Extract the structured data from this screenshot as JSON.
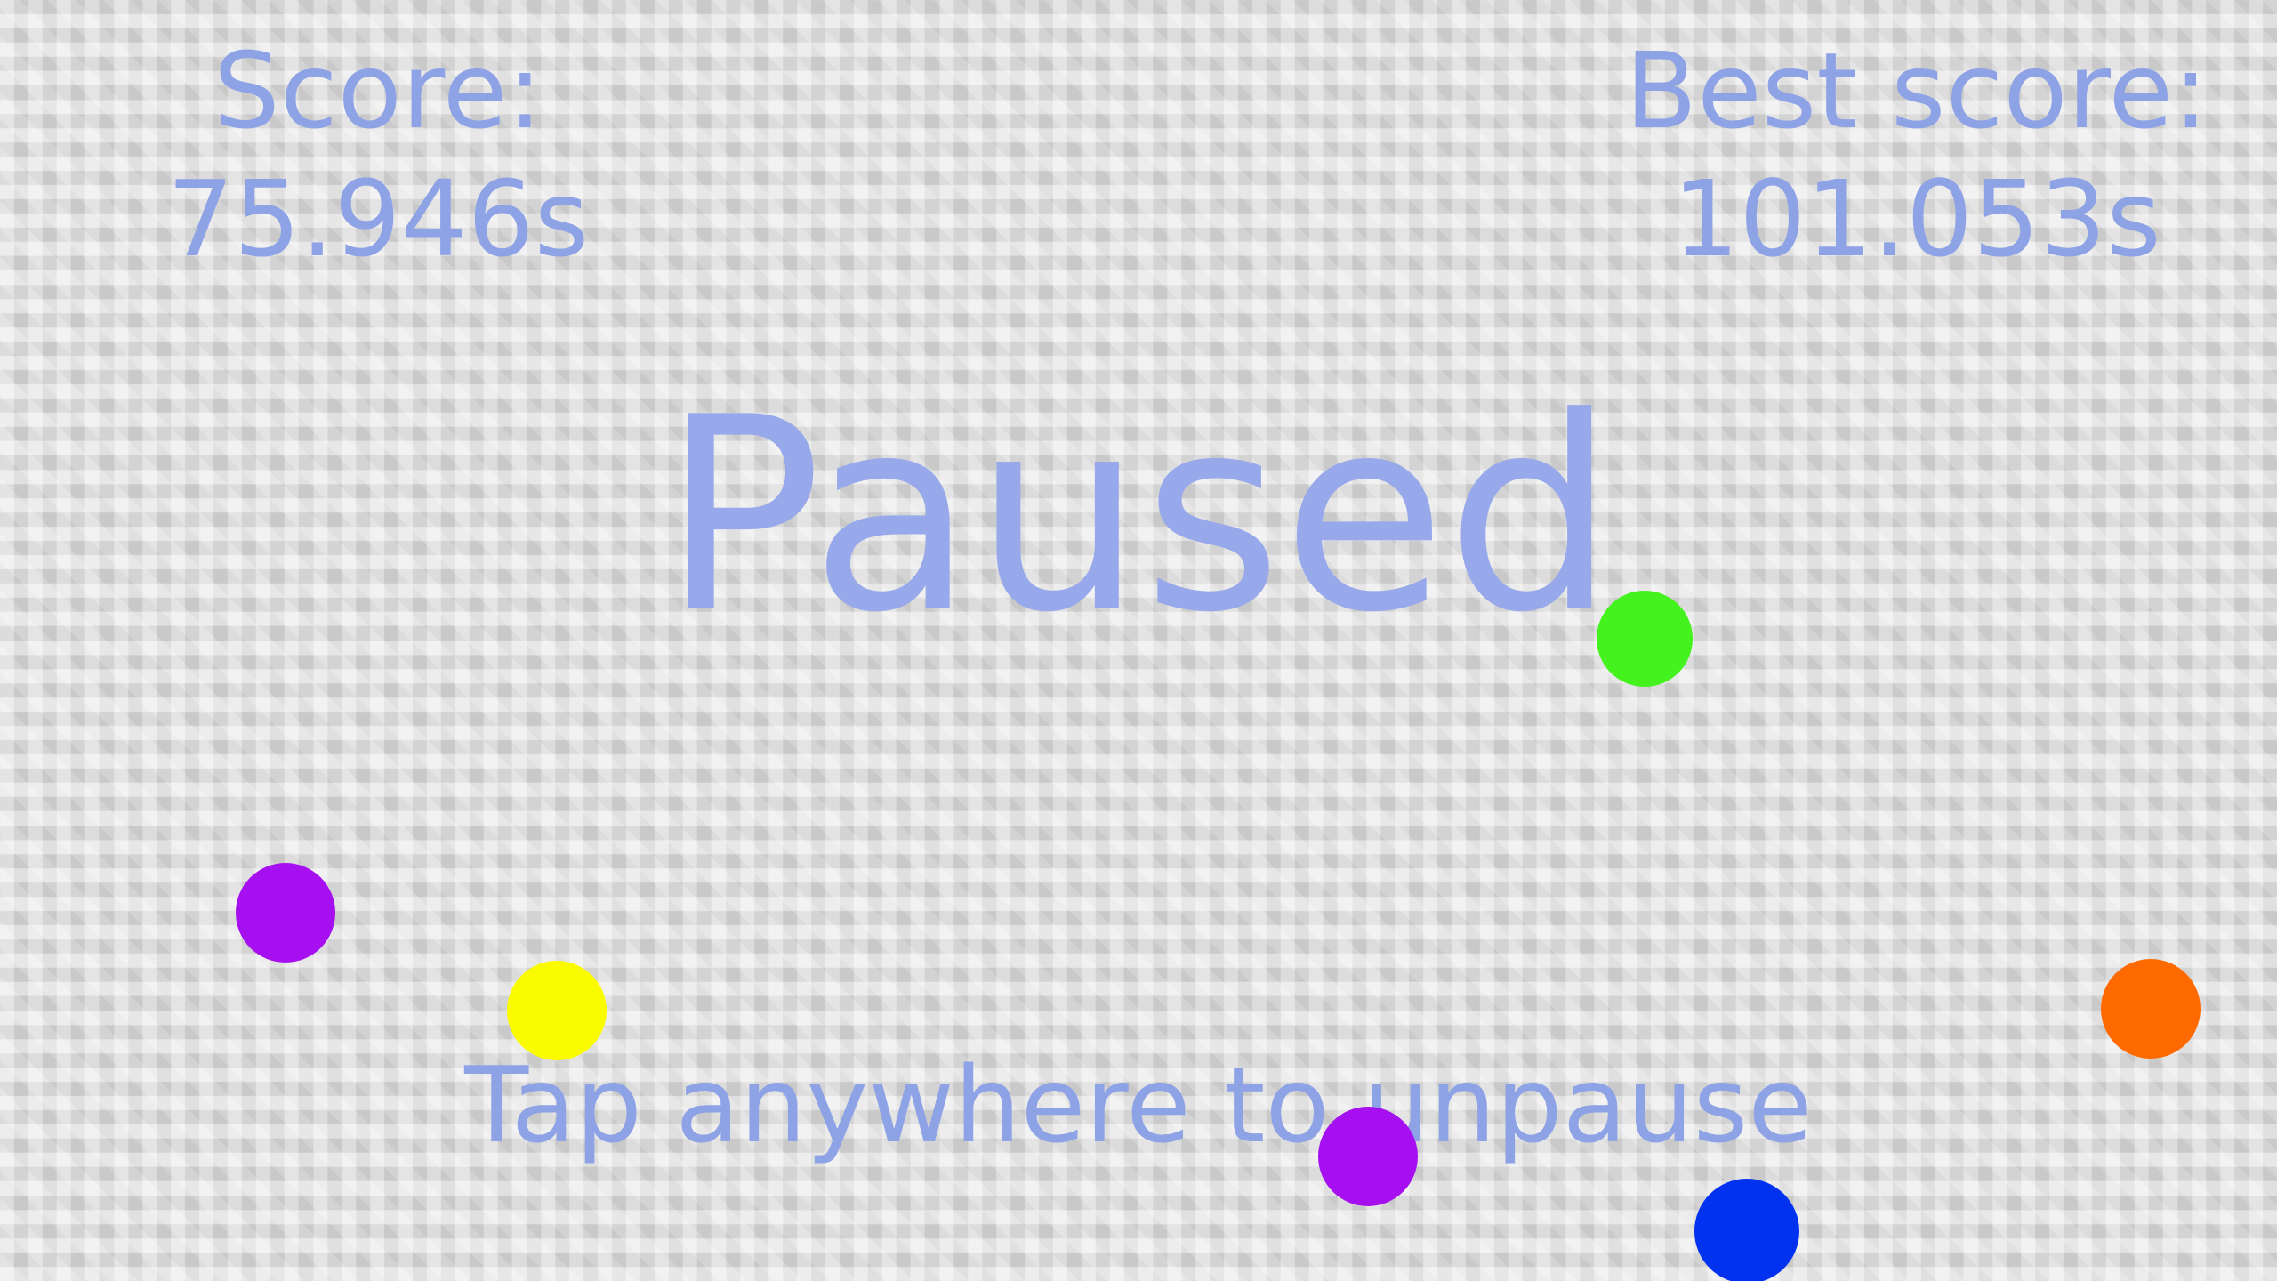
{
  "hud": {
    "score_label": "Score:",
    "score_value": "75.946s",
    "best_label": "Best score:",
    "best_value": "101.053s"
  },
  "overlay": {
    "title": "Paused",
    "hint": "Tap anywhere to unpause"
  },
  "balls": [
    {
      "id": "green",
      "color": "#44f21e"
    },
    {
      "id": "purple-1",
      "color": "#a60ff0"
    },
    {
      "id": "yellow",
      "color": "#fbfb00"
    },
    {
      "id": "purple-2",
      "color": "#a60ff0"
    },
    {
      "id": "blue",
      "color": "#0032f0"
    },
    {
      "id": "orange",
      "color": "#ff6a00"
    }
  ],
  "colors": {
    "text": "#8ea2e6",
    "background": "#dedede"
  }
}
